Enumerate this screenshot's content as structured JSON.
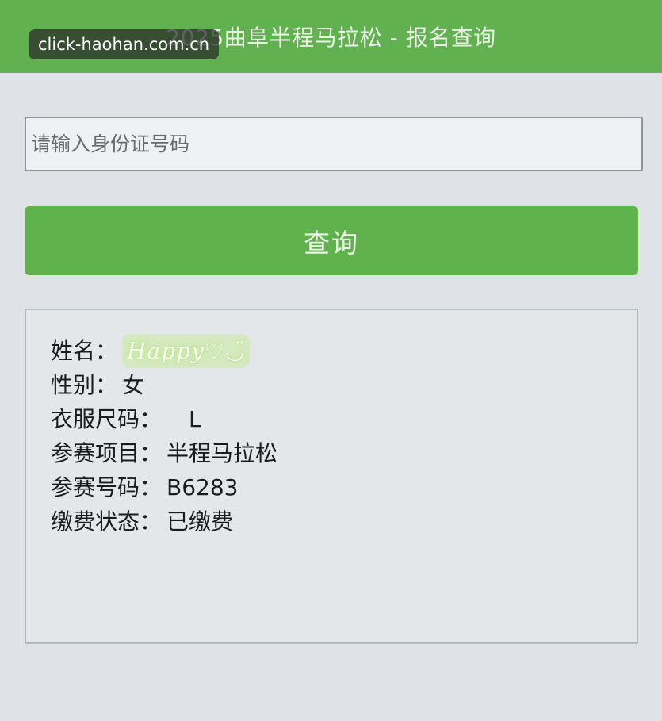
{
  "header": {
    "title": "2025曲阜半程马拉松 - 报名查询",
    "watermark": "click-haohan.com.cn"
  },
  "search": {
    "placeholder": "请输入身份证号码",
    "value": ""
  },
  "query_button": {
    "label": "查询"
  },
  "result": {
    "rows": [
      {
        "label": "姓名：",
        "value": "Happy♡◡̈"
      },
      {
        "label": "性别：",
        "value": "女"
      },
      {
        "label": "衣服尺码：",
        "value": "L"
      },
      {
        "label": "参赛项目：",
        "value": "半程马拉松"
      },
      {
        "label": "参赛号码：",
        "value": "B6283"
      },
      {
        "label": "缴费状态：",
        "value": "已缴费"
      }
    ]
  },
  "colors": {
    "brand_green": "#62b150",
    "button_green": "#5fb24c",
    "background": "#dfe3e7"
  }
}
